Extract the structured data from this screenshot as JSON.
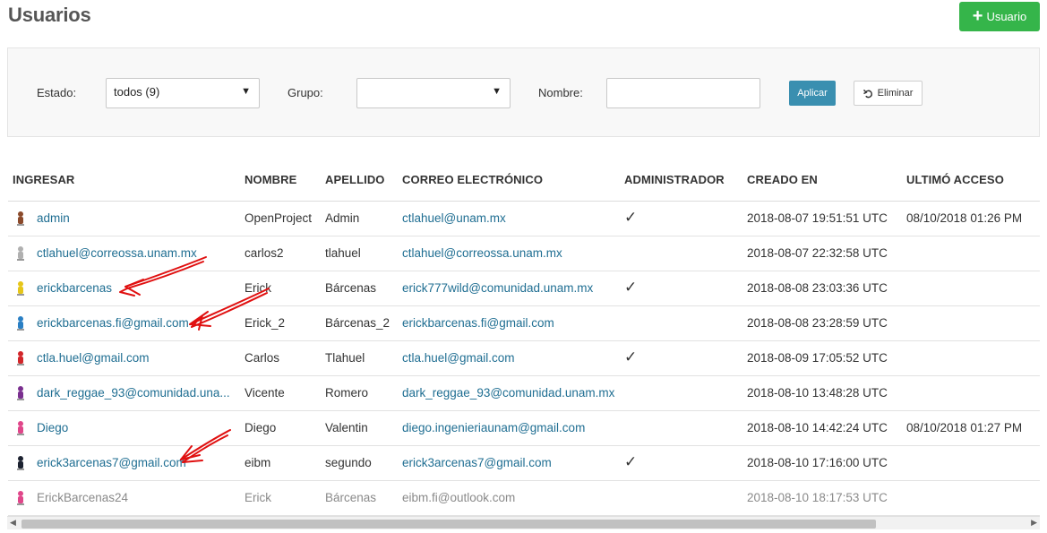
{
  "header": {
    "title": "Usuarios",
    "add_button": "Usuario"
  },
  "filters": {
    "estado_label": "Estado:",
    "estado_value": "todos (9)",
    "grupo_label": "Grupo:",
    "grupo_value": "",
    "nombre_label": "Nombre:",
    "nombre_value": "",
    "apply": "Aplicar",
    "clear": "Eliminar"
  },
  "table": {
    "headers": [
      "INGRESAR",
      "NOMBRE",
      "APELLIDO",
      "CORREO ELECTRÓNICO",
      "ADMINISTRADOR",
      "CREADO EN",
      "ULTIMÓ ACCESO"
    ],
    "rows": [
      {
        "login": "admin",
        "first": "OpenProject",
        "last": "Admin",
        "email": "ctlahuel@unam.mx",
        "admin": "✓",
        "created": "2018-08-07 19:51:51 UTC",
        "last_access": "08/10/2018 01:26 PM",
        "avatar_color": "#8b4a2b",
        "locked": false
      },
      {
        "login": "ctlahuel@correossa.unam.mx",
        "first": "carlos2",
        "last": "tlahuel",
        "email": "ctlahuel@correossa.unam.mx",
        "admin": "",
        "created": "2018-08-07 22:32:58 UTC",
        "last_access": "",
        "avatar_color": "#b0b0b0",
        "locked": false
      },
      {
        "login": "erickbarcenas",
        "first": "Erick",
        "last": "Bárcenas",
        "email": "erick777wild@comunidad.unam.mx",
        "admin": "✓",
        "created": "2018-08-08 23:03:36 UTC",
        "last_access": "",
        "avatar_color": "#e6c619",
        "locked": false
      },
      {
        "login": "erickbarcenas.fi@gmail.com",
        "first": "Erick_2",
        "last": "Bárcenas_2",
        "email": "erickbarcenas.fi@gmail.com",
        "admin": "",
        "created": "2018-08-08 23:28:59 UTC",
        "last_access": "",
        "avatar_color": "#2a7fc4",
        "locked": false
      },
      {
        "login": "ctla.huel@gmail.com",
        "first": "Carlos",
        "last": "Tlahuel",
        "email": "ctla.huel@gmail.com",
        "admin": "✓",
        "created": "2018-08-09 17:05:52 UTC",
        "last_access": "",
        "avatar_color": "#d2262a",
        "locked": false
      },
      {
        "login": "dark_reggae_93@comunidad.una...",
        "first": "Vicente",
        "last": "Romero",
        "email": "dark_reggae_93@comunidad.unam.mx",
        "admin": "",
        "created": "2018-08-10 13:48:28 UTC",
        "last_access": "",
        "avatar_color": "#7a2f8f",
        "locked": false
      },
      {
        "login": "Diego",
        "first": "Diego",
        "last": "Valentin",
        "email": "diego.ingenieriaunam@gmail.com",
        "admin": "",
        "created": "2018-08-10 14:42:24 UTC",
        "last_access": "08/10/2018 01:27 PM",
        "avatar_color": "#e0468a",
        "locked": false
      },
      {
        "login": "erick3arcenas7@gmail.com",
        "first": "eibm",
        "last": "segundo",
        "email": "erick3arcenas7@gmail.com",
        "admin": "✓",
        "created": "2018-08-10 17:16:00 UTC",
        "last_access": "",
        "avatar_color": "#1c2230",
        "locked": false
      },
      {
        "login": "ErickBarcenas24",
        "first": "Erick",
        "last": "Bárcenas",
        "email": "eibm.fi@outlook.com",
        "admin": "",
        "created": "2018-08-10 18:17:53 UTC",
        "last_access": "",
        "avatar_color": "#e0468a",
        "locked": true
      }
    ]
  },
  "colors": {
    "accent_green": "#35b54a",
    "apply_blue": "#3a8fb0",
    "link": "#1f6e92",
    "annotation_red": "#e01010"
  }
}
